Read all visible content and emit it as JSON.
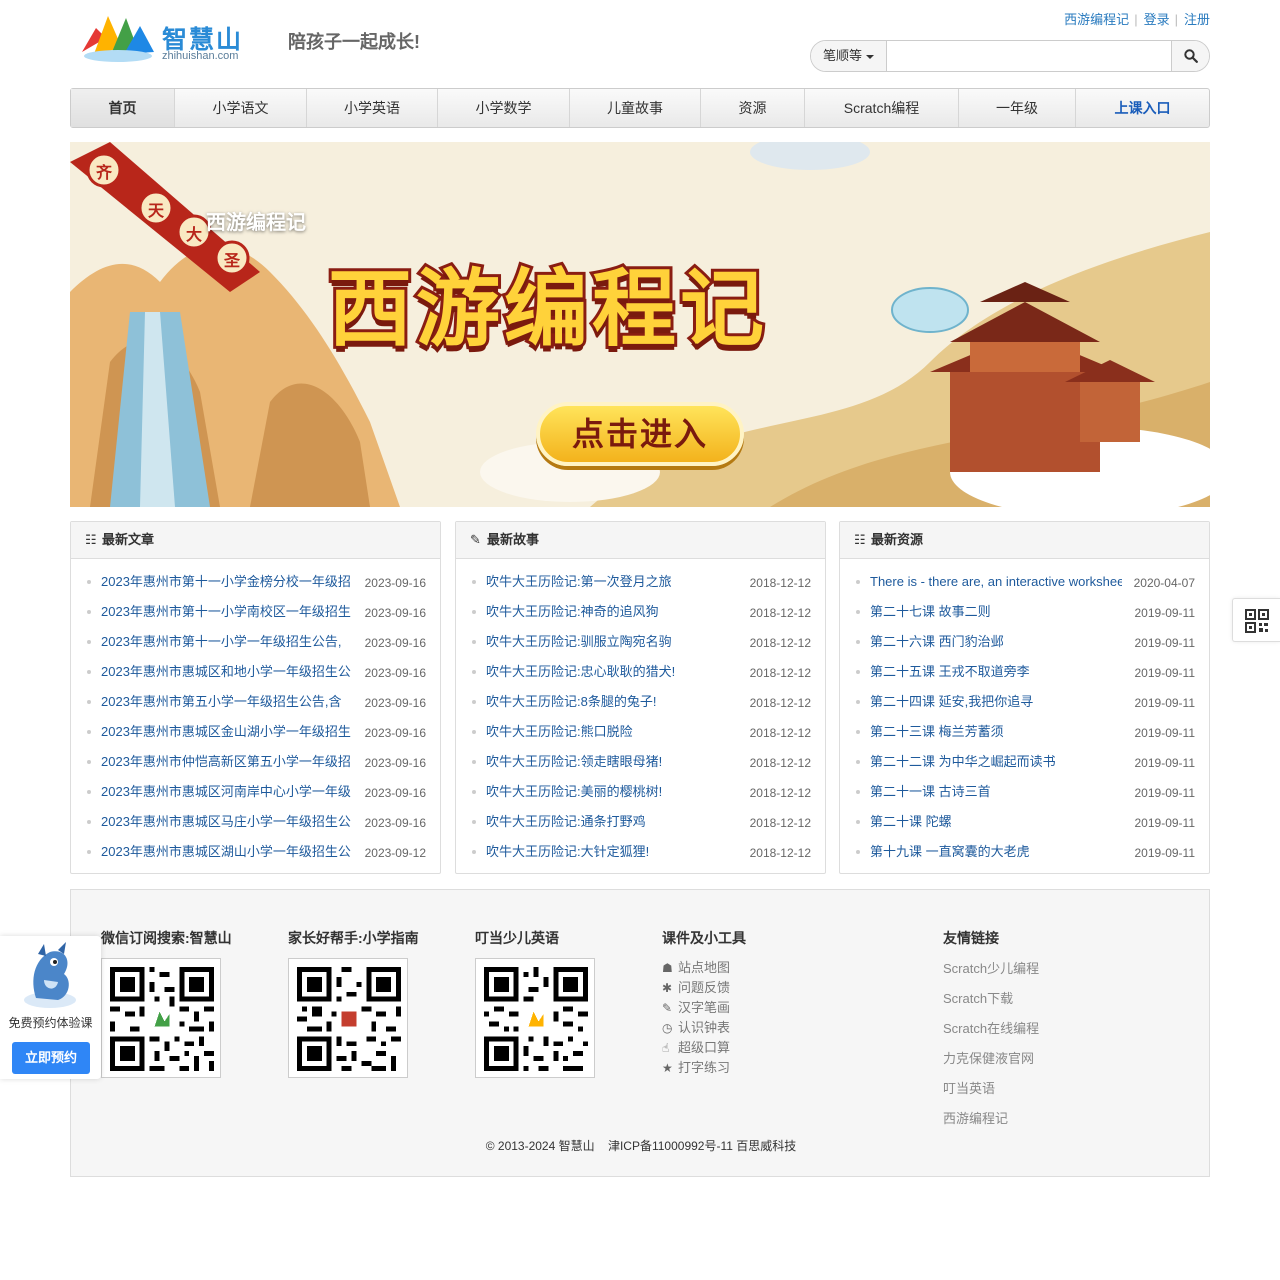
{
  "header": {
    "logo_cn": "智慧山",
    "logo_en": "zhihuishan.com",
    "slogan": "陪孩子一起成长!",
    "top_links": [
      "西游编程记",
      "登录",
      "注册"
    ]
  },
  "search": {
    "select_label": "笔顺等",
    "placeholder": ""
  },
  "nav": {
    "items": [
      "首页",
      "小学语文",
      "小学英语",
      "小学数学",
      "儿童故事",
      "资源",
      "Scratch编程",
      "一年级",
      "上课入口"
    ]
  },
  "banner": {
    "tag": "西游编程记",
    "title": "西游编程记",
    "enter": "点击进入",
    "badge": [
      "齐",
      "天",
      "大",
      "圣"
    ]
  },
  "panels": [
    {
      "title": "最新文章",
      "items": [
        {
          "text": "2023年惠州市第十一小学金榜分校一年级招",
          "date": "2023-09-16"
        },
        {
          "text": "2023年惠州市第十一小学南校区一年级招生",
          "date": "2023-09-16"
        },
        {
          "text": "2023年惠州市第十一小学一年级招生公告,",
          "date": "2023-09-16"
        },
        {
          "text": "2023年惠州市惠城区和地小学一年级招生公",
          "date": "2023-09-16"
        },
        {
          "text": "2023年惠州市第五小学一年级招生公告,含",
          "date": "2023-09-16"
        },
        {
          "text": "2023年惠州市惠城区金山湖小学一年级招生",
          "date": "2023-09-16"
        },
        {
          "text": "2023年惠州市仲恺高新区第五小学一年级招",
          "date": "2023-09-16"
        },
        {
          "text": "2023年惠州市惠城区河南岸中心小学一年级",
          "date": "2023-09-16"
        },
        {
          "text": "2023年惠州市惠城区马庄小学一年级招生公",
          "date": "2023-09-16"
        },
        {
          "text": "2023年惠州市惠城区湖山小学一年级招生公",
          "date": "2023-09-12"
        }
      ]
    },
    {
      "title": "最新故事",
      "items": [
        {
          "text": "吹牛大王历险记:第一次登月之旅",
          "date": "2018-12-12"
        },
        {
          "text": "吹牛大王历险记:神奇的追风狗",
          "date": "2018-12-12"
        },
        {
          "text": "吹牛大王历险记:驯服立陶宛名驹",
          "date": "2018-12-12"
        },
        {
          "text": "吹牛大王历险记:忠心耿耿的猎犬!",
          "date": "2018-12-12"
        },
        {
          "text": "吹牛大王历险记:8条腿的兔子!",
          "date": "2018-12-12"
        },
        {
          "text": "吹牛大王历险记:熊口脱险",
          "date": "2018-12-12"
        },
        {
          "text": "吹牛大王历险记:领走瞎眼母猪!",
          "date": "2018-12-12"
        },
        {
          "text": "吹牛大王历险记:美丽的樱桃树!",
          "date": "2018-12-12"
        },
        {
          "text": "吹牛大王历险记:通条打野鸡",
          "date": "2018-12-12"
        },
        {
          "text": "吹牛大王历险记:大针定狐狸!",
          "date": "2018-12-12"
        }
      ]
    },
    {
      "title": "最新资源",
      "items": [
        {
          "text": "There is - there are, an interactive worksheet",
          "date": "2020-04-07"
        },
        {
          "text": "第二十七课 故事二则",
          "date": "2019-09-11"
        },
        {
          "text": "第二十六课 西门豹治邺",
          "date": "2019-09-11"
        },
        {
          "text": "第二十五课 王戎不取道旁李",
          "date": "2019-09-11"
        },
        {
          "text": "第二十四课 延安,我把你追寻",
          "date": "2019-09-11"
        },
        {
          "text": "第二十三课 梅兰芳蓄须",
          "date": "2019-09-11"
        },
        {
          "text": "第二十二课 为中华之崛起而读书",
          "date": "2019-09-11"
        },
        {
          "text": "第二十一课 古诗三首",
          "date": "2019-09-11"
        },
        {
          "text": "第二十课 陀螺",
          "date": "2019-09-11"
        },
        {
          "text": "第十九课 一直窝囊的大老虎",
          "date": "2019-09-11"
        }
      ]
    }
  ],
  "footer": {
    "qr_titles": [
      "微信订阅搜索:智慧山",
      "家长好帮手:小学指南",
      "叮当少儿英语"
    ],
    "tools_title": "课件及小工具",
    "tools": [
      {
        "icon": "sitemap-icon",
        "label": "站点地图"
      },
      {
        "icon": "bug-icon",
        "label": "问题反馈"
      },
      {
        "icon": "pencil-icon",
        "label": "汉字笔画"
      },
      {
        "icon": "clock-icon",
        "label": "认识钟表"
      },
      {
        "icon": "thumbs-up-icon",
        "label": "超级口算"
      },
      {
        "icon": "star-icon",
        "label": "打字练习"
      }
    ],
    "links_title": "友情链接",
    "links": [
      "Scratch少儿编程",
      "Scratch下载",
      "Scratch在线编程",
      "力克保健液官网",
      "叮当英语",
      "西游编程记"
    ],
    "copyright": "© 2013-2024 智慧山",
    "icp": "津ICP备11000992号-11 百思威科技"
  },
  "promo": {
    "text": "免费预约体验课",
    "button": "立即预约"
  }
}
